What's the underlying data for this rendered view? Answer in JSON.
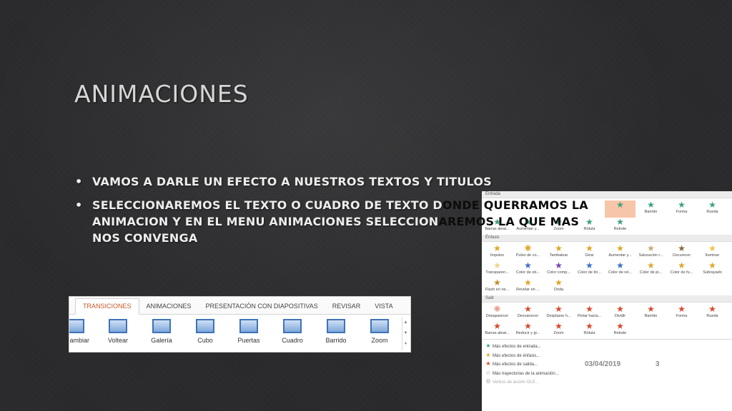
{
  "slide": {
    "title": "ANIMACIONES",
    "date": "03/04/2019",
    "number": "3"
  },
  "bullets": {
    "b1": "VAMOS A DARLE UN EFECTO A NUESTROS TEXTOS Y TITULOS",
    "b2_l1a": "SELECCIONAREMOS EL TEXTO O CUADRO DE TEXTO D",
    "b2_l1b": "ONDE QUERRAMOS LA",
    "b2_l2a": "ANIMACION Y EN EL MENU ANIMACIONES SELECCION",
    "b2_l2b": "AREMOS LA QUE MAS",
    "b2_l3": "NOS CONVENGA"
  },
  "ribbon": {
    "tabs": [
      "TRANSICIONES",
      "ANIMACIONES",
      "PRESENTACIÓN CON DIAPOSITIVAS",
      "REVISAR",
      "VISTA"
    ],
    "items": [
      "ambiar",
      "Voltear",
      "Galería",
      "Cubo",
      "Puertas",
      "Cuadro",
      "Barrido",
      "Zoom"
    ]
  },
  "gallery": {
    "sec_entrada": "Entrada",
    "entrada": [
      "Barrido",
      "Forma",
      "Rueda",
      "Barras aleat...",
      "Aumentar y...",
      "Zoom",
      "Rótula",
      "Rebote"
    ],
    "sec_enfasis": "Énfasis",
    "enfasis": [
      "Impulso",
      "Pulso de co...",
      "Tambalear",
      "Girar",
      "Aumentar y...",
      "Saturación r...",
      "Oscurecer",
      "Iluminar",
      "Transparen...",
      "Color de ob...",
      "Color comp...",
      "Color de lín...",
      "Color de rel...",
      "Color de pi...",
      "Color de fu...",
      "Subrayado",
      "Flash en ne...",
      "Revelar en ...",
      "Onda"
    ],
    "sec_salir": "Salir",
    "salir": [
      "Desaparecer",
      "Desvanecer",
      "Desplazar h...",
      "Flotar hacia...",
      "Dividir",
      "Barrido",
      "Forma",
      "Rueda",
      "Barras aleat...",
      "Reducir y gi...",
      "Zoom",
      "Rótula",
      "Rebote"
    ],
    "links": [
      "Más efectos de entrada...",
      "Más efectos de énfasis...",
      "Más efectos de salida...",
      "Más trayectorias de la animación...",
      "Verbos de acción OLE..."
    ],
    "colors": {
      "entrada": "#3aa17e",
      "enfasis": "#e0a526",
      "salir": "#d9472b",
      "selected_bg": "#f7c6a8"
    }
  }
}
